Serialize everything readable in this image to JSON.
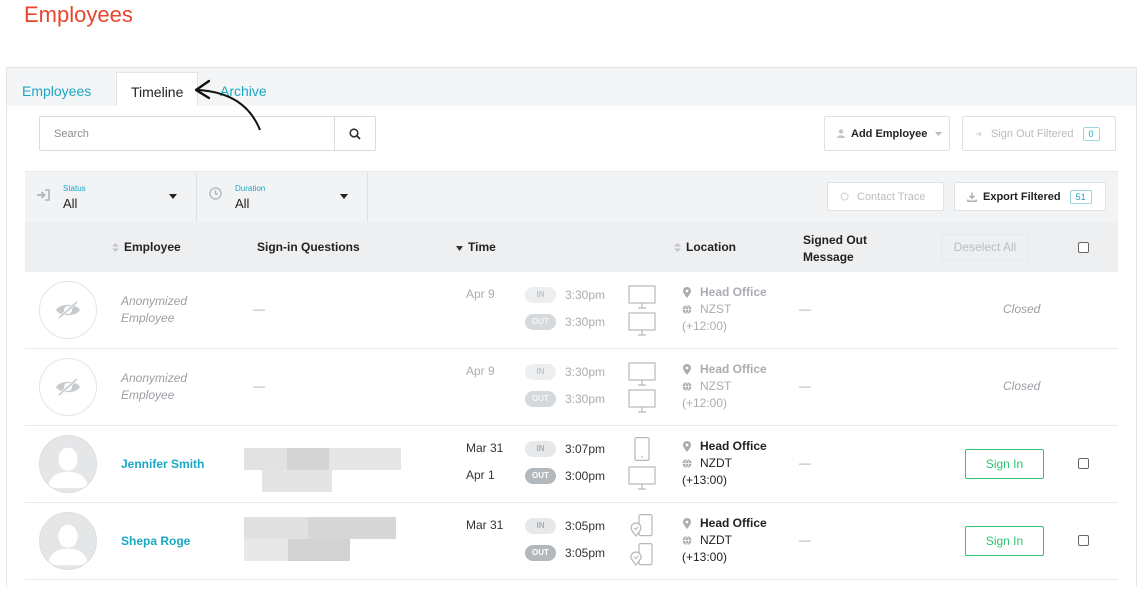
{
  "page_title": "Employees",
  "tabs": [
    {
      "label": "Employees",
      "active": false
    },
    {
      "label": "Timeline",
      "active": true
    },
    {
      "label": "Archive",
      "active": false
    }
  ],
  "search": {
    "placeholder": "Search"
  },
  "toolbar": {
    "add_employee_label": "Add Employee",
    "sign_out_filtered_label": "Sign Out Filtered",
    "sign_out_filtered_count": "0",
    "contact_trace_label": "Contact Trace",
    "export_filtered_label": "Export Filtered",
    "export_filtered_count": "51"
  },
  "filters": {
    "status": {
      "label": "Status",
      "value": "All"
    },
    "duration": {
      "label": "Duration",
      "value": "All"
    }
  },
  "table": {
    "headers": {
      "employee": "Employee",
      "questions": "Sign-in Questions",
      "time": "Time",
      "location": "Location",
      "message_line1": "Signed Out",
      "message_line2": "Message",
      "deselect_all": "Deselect All"
    },
    "rows": [
      {
        "name_line1": "Anonymized",
        "name_line2": "Employee",
        "questions": "—",
        "date_in": "Apr 9",
        "date_out": "",
        "status_in": "IN",
        "time_in": "3:30pm",
        "status_out": "OUT",
        "time_out": "3:30pm",
        "device_in": "monitor-icon",
        "device_out": "monitor-icon",
        "location": "Head Office",
        "tz": "NZST",
        "offset": "(+12:00)",
        "message": "—",
        "action": "Closed"
      },
      {
        "name_line1": "Anonymized",
        "name_line2": "Employee",
        "questions": "—",
        "date_in": "Apr 9",
        "date_out": "",
        "status_in": "IN",
        "time_in": "3:30pm",
        "status_out": "OUT",
        "time_out": "3:30pm",
        "device_in": "monitor-icon",
        "device_out": "monitor-icon",
        "location": "Head Office",
        "tz": "NZST",
        "offset": "(+12:00)",
        "message": "—",
        "action": "Closed"
      },
      {
        "name": "Jennifer Smith",
        "date_in": "Mar 31",
        "date_out": "Apr 1",
        "status_in": "IN",
        "time_in": "3:07pm",
        "status_out": "OUT",
        "time_out": "3:00pm",
        "device_in": "phone-icon",
        "device_out": "monitor-icon",
        "location": "Head Office",
        "tz": "NZDT",
        "offset": "(+13:00)",
        "message": "—",
        "action": "Sign In"
      },
      {
        "name": "Shepa Roge",
        "date_in": "Mar 31",
        "date_out": "",
        "status_in": "IN",
        "time_in": "3:05pm",
        "status_out": "OUT",
        "time_out": "3:05pm",
        "device_in": "location-phone-icon",
        "device_out": "location-phone-icon",
        "location": "Head Office",
        "tz": "NZDT",
        "offset": "(+13:00)",
        "message": "—",
        "action": "Sign In"
      }
    ]
  },
  "colors": {
    "title": "#e8452c",
    "accent": "#1aa7c4",
    "success": "#2ec470"
  }
}
